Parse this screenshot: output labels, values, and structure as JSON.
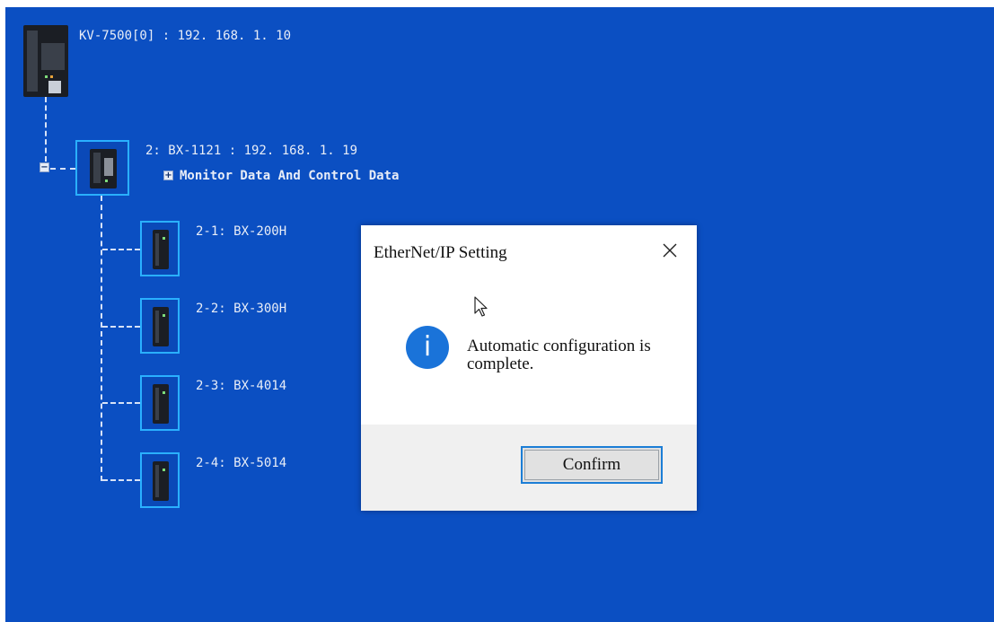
{
  "controller": {
    "label": "KV-7500[0] : 192. 168. 1. 10"
  },
  "adapter": {
    "label": "2: BX-1121 : 192. 168. 1. 19",
    "sub_label": "Monitor Data And Control Data",
    "expander_symbol": "+"
  },
  "collapse_symbol": "−",
  "modules": [
    {
      "label": "2-1: BX-200H"
    },
    {
      "label": "2-2: BX-300H"
    },
    {
      "label": "2-3: BX-4014"
    },
    {
      "label": "2-4: BX-5014"
    }
  ],
  "dialog": {
    "title": "EtherNet/IP Setting",
    "message": "Automatic configuration is complete.",
    "confirm_label": "Confirm",
    "info_glyph": "i"
  },
  "icons": {
    "close": "close-icon",
    "info": "info-icon",
    "cursor": "mouse-pointer-icon"
  },
  "colors": {
    "background": "#0b4fc2",
    "module_frame": "#2ab0ff",
    "info_icon": "#1a73d9",
    "button_focus": "#1c7ed6"
  }
}
